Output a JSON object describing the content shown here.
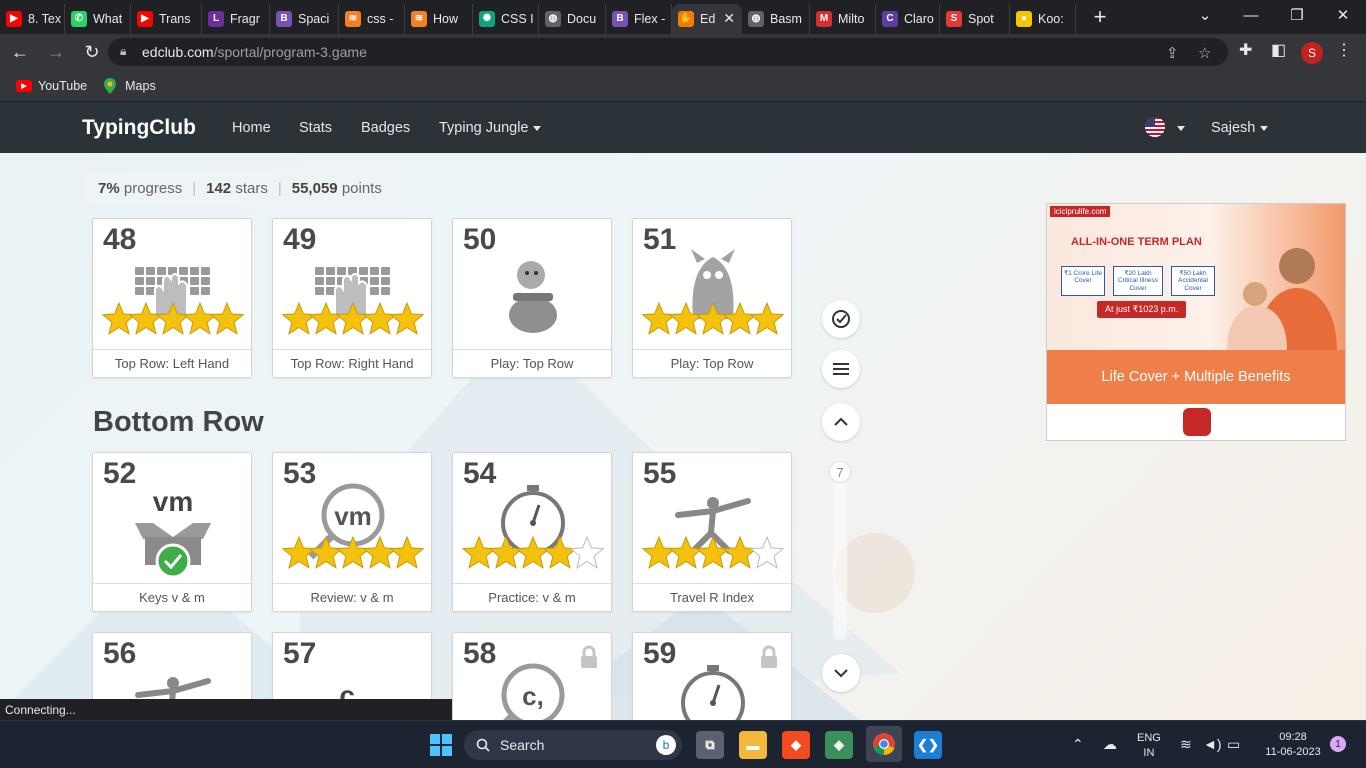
{
  "browser": {
    "tabs": [
      {
        "title": "8. Tex",
        "icon": "youtube-icon",
        "color": "#ff0000",
        "glyph": "▶"
      },
      {
        "title": "What",
        "icon": "whatsapp-icon",
        "color": "#25d366",
        "glyph": "✆"
      },
      {
        "title": "Trans",
        "icon": "youtube-icon",
        "color": "#ff0000",
        "glyph": "▶"
      },
      {
        "title": "Fragr",
        "icon": "l-app-icon",
        "color": "#6b2fa0",
        "glyph": "L"
      },
      {
        "title": "Spaci",
        "icon": "bootstrap-icon",
        "color": "#7952b3",
        "glyph": "B"
      },
      {
        "title": "css -",
        "icon": "stackoverflow-icon",
        "color": "#f48024",
        "glyph": "≋"
      },
      {
        "title": "How",
        "icon": "stackoverflow-icon",
        "color": "#f48024",
        "glyph": "≋"
      },
      {
        "title": "CSS I",
        "icon": "chatgpt-icon",
        "color": "#10a37f",
        "glyph": "✺"
      },
      {
        "title": "Docu",
        "icon": "globe-icon",
        "color": "#5f6368",
        "glyph": "◍"
      },
      {
        "title": "Flex -",
        "icon": "bootstrap-icon",
        "color": "#7952b3",
        "glyph": "B"
      },
      {
        "title": "Ed",
        "icon": "typingclub-icon",
        "color": "#f57c00",
        "glyph": "✋",
        "active": true
      },
      {
        "title": "Basm",
        "icon": "globe-icon",
        "color": "#5f6368",
        "glyph": "◍"
      },
      {
        "title": "Milto",
        "icon": "m-app-icon",
        "color": "#d32f2f",
        "glyph": "M"
      },
      {
        "title": "Claro",
        "icon": "claro-icon",
        "color": "#5b3fa0",
        "glyph": "C"
      },
      {
        "title": "Spot",
        "icon": "s-app-icon",
        "color": "#e53935",
        "glyph": "S"
      },
      {
        "title": "Koo:",
        "icon": "koo-icon",
        "color": "#f5c400",
        "glyph": "●"
      }
    ],
    "close_tab_glyph": "✕",
    "new_tab_glyph": "+",
    "url_domain": "edclub.com",
    "url_path": "/sportal/program-3.game",
    "profile_initial": "S",
    "bookmarks": [
      {
        "label": "YouTube",
        "icon": "youtube-icon"
      },
      {
        "label": "Maps",
        "icon": "maps-pin-icon"
      }
    ],
    "status_text": "Connecting..."
  },
  "site": {
    "logo": "TypingClub",
    "nav": {
      "home": "Home",
      "stats": "Stats",
      "badges": "Badges",
      "typing_jungle": "Typing Jungle",
      "user": "Sajesh"
    },
    "progress": {
      "percent": "7%",
      "percent_label": "progress",
      "stars": "142",
      "stars_label": "stars",
      "points": "55,059",
      "points_label": "points"
    },
    "section_title": "Bottom Row",
    "scroll_badge": "7",
    "lessons": [
      {
        "number": "48",
        "label": "Top Row: Left Hand",
        "stars": 5,
        "art": "keyboard-left-hand-icon"
      },
      {
        "number": "49",
        "label": "Top Row: Right Hand",
        "stars": 5,
        "art": "keyboard-right-hand-icon"
      },
      {
        "number": "50",
        "label": "Play: Top Row",
        "stars": 0,
        "art": "game-character-pot-icon"
      },
      {
        "number": "51",
        "label": "Play: Top Row",
        "stars": 5,
        "art": "game-monster-icon"
      },
      {
        "number": "52",
        "label": "Keys v & m",
        "stars": 0,
        "art": "new-keys-box-icon",
        "art_text": "vm"
      },
      {
        "number": "53",
        "label": "Review: v & m",
        "stars": 5,
        "art": "magnifier-review-icon",
        "art_text": "vm"
      },
      {
        "number": "54",
        "label": "Practice: v & m",
        "stars": 4,
        "art": "stopwatch-icon"
      },
      {
        "number": "55",
        "label": "Travel R Index",
        "stars": 4,
        "art": "yoga-pose-icon"
      },
      {
        "number": "56",
        "label": "",
        "stars": 0,
        "art": "yoga-pose-icon"
      },
      {
        "number": "57",
        "label": "",
        "stars": 0,
        "art": "new-key-c-icon",
        "art_text": "c,"
      },
      {
        "number": "58",
        "label": "",
        "stars": 0,
        "art": "magnifier-review-icon",
        "art_text": "c,",
        "locked": true
      },
      {
        "number": "59",
        "label": "",
        "stars": 0,
        "art": "stopwatch-icon",
        "locked": true
      }
    ]
  },
  "ad": {
    "brand": "iciciprulife.com",
    "headline": "ALL-IN-ONE TERM PLAN",
    "benefits": [
      "₹1 Crore Life Cover",
      "₹20 Lakh Critical Illness Cover",
      "₹50 Lakh Accidental Cover"
    ],
    "price": "At just ₹1023 p.m.",
    "cta": "Life Cover + Multiple Benefits"
  },
  "taskbar": {
    "search_label": "Search",
    "lang_top": "ENG",
    "lang_bottom": "IN",
    "time": "09:28",
    "date": "11-06-2023",
    "notification_count": "1"
  },
  "colors": {
    "star_gold": "#f4c20d",
    "nav_bg": "#2b3238",
    "ad_orange": "#ee7f48"
  }
}
